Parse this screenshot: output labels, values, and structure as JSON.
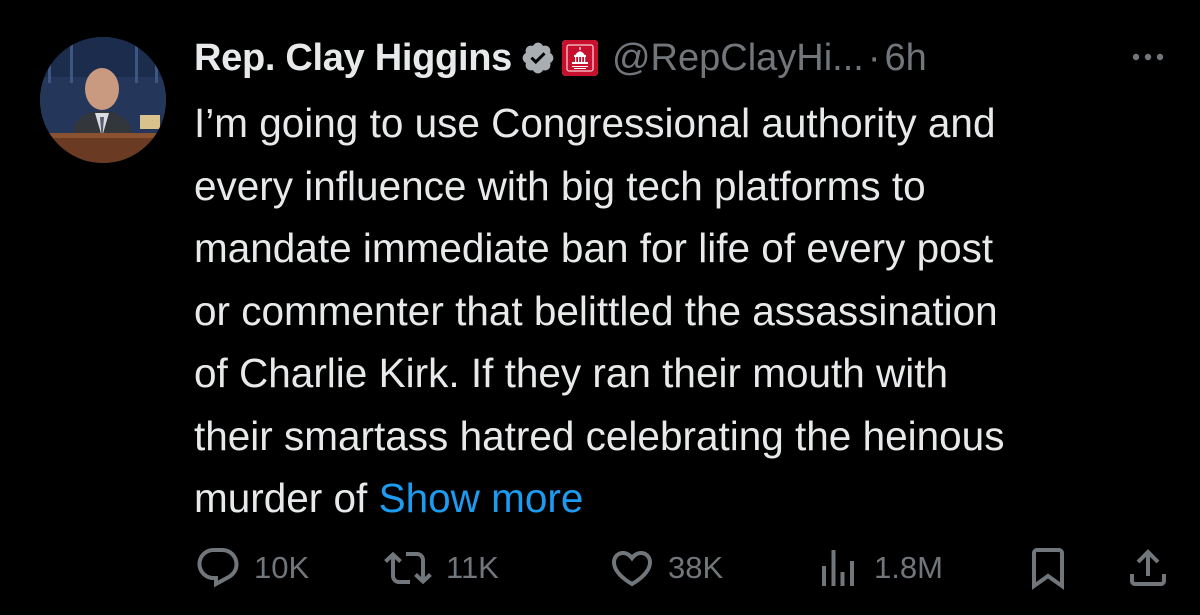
{
  "tweet": {
    "author": {
      "display_name": "Rep. Clay Higgins",
      "handle": "@RepClayHi...",
      "verified_icon": "verified-badge-icon",
      "affiliation_icon": "gop-capitol-badge-icon"
    },
    "separator": "·",
    "time": "6h",
    "text_lines": [
      "I’m going to use Congressional authority and",
      "every influence with big tech platforms to",
      "mandate immediate ban for life of every post",
      "or commenter that belittled the assassination",
      "of Charlie Kirk. If they ran their mouth with",
      "their smartass hatred celebrating the heinous",
      "murder of"
    ],
    "show_more": "Show more",
    "actions": {
      "replies": "10K",
      "reposts": "11K",
      "likes": "38K",
      "views": "1.8M"
    }
  },
  "colors": {
    "background": "#000000",
    "text": "#e7e9ea",
    "muted": "#71767b",
    "link": "#1d9bf0",
    "gop_red": "#c8102e"
  }
}
